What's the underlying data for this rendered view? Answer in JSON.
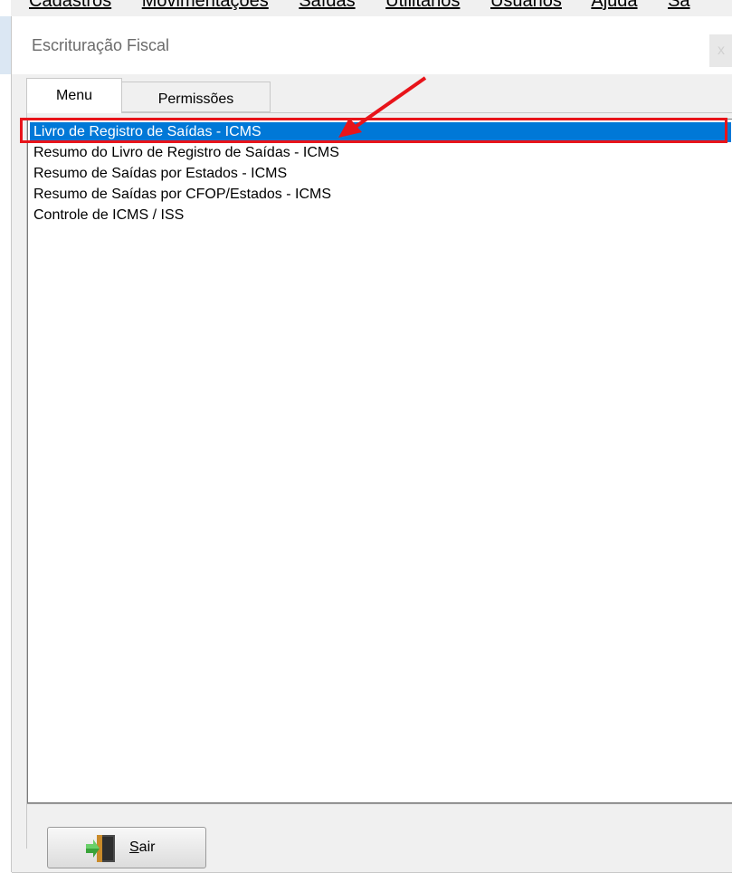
{
  "menubar": {
    "items": [
      "Cadastros",
      "Movimentações",
      "Saídas",
      "Utilitários",
      "Usuários",
      "Ajuda",
      "Sa"
    ]
  },
  "window": {
    "title": "Escrituração Fiscal",
    "close_label": "x"
  },
  "tabs": [
    {
      "label": "Menu",
      "active": true
    },
    {
      "label": "Permissões",
      "active": false
    }
  ],
  "list": {
    "items": [
      {
        "label": "Livro de Registro de Saídas - ICMS",
        "selected": true
      },
      {
        "label": "Resumo do Livro de Registro de Saídas - ICMS",
        "selected": false
      },
      {
        "label": "Resumo de Saídas por Estados - ICMS",
        "selected": false
      },
      {
        "label": "Resumo de Saídas por CFOP/Estados - ICMS",
        "selected": false
      },
      {
        "label": "Controle de ICMS / ISS",
        "selected": false
      }
    ]
  },
  "footer": {
    "exit_label": "Sair",
    "exit_icon": "exit-door-icon"
  },
  "colors": {
    "selection": "#0078d7",
    "annotation": "#e8141a"
  }
}
